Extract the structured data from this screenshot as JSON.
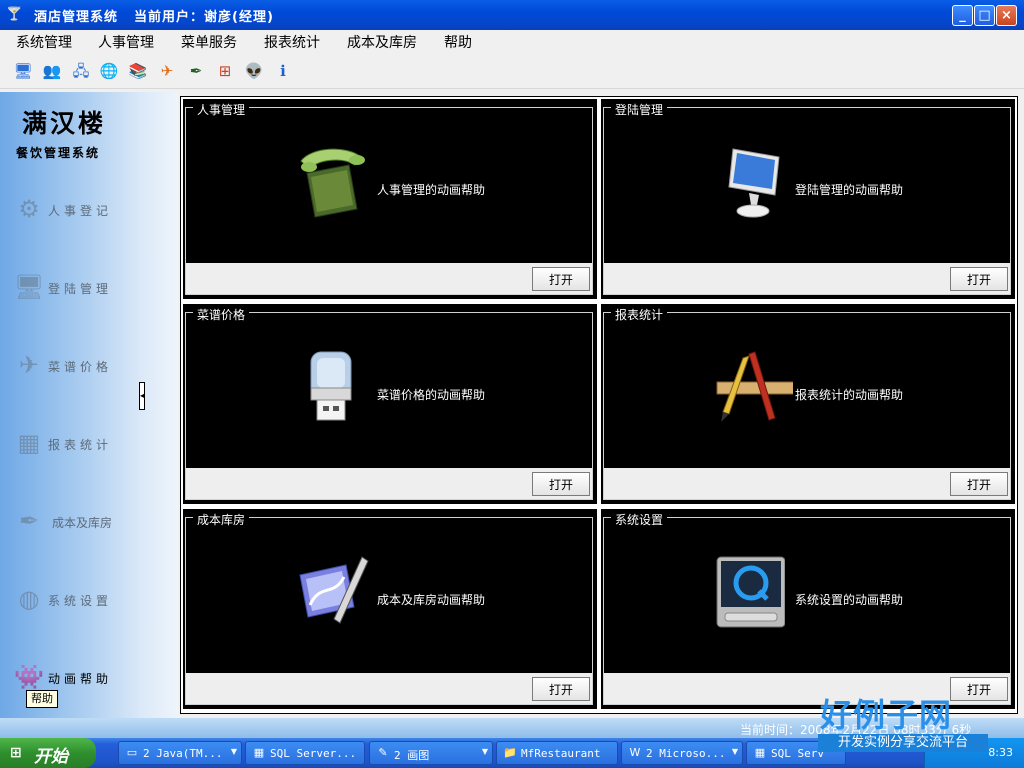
{
  "window": {
    "title": "酒店管理系统",
    "user": "当前用户：谢彦(经理)",
    "controls": {
      "minimize": "_",
      "maximize": "□",
      "close": "×"
    }
  },
  "menus": [
    "系统管理",
    "人事管理",
    "菜单服务",
    "报表统计",
    "成本及库房",
    "帮助"
  ],
  "toolbar": {
    "icons": [
      "monitor-icon",
      "users-icon",
      "network-icon",
      "globe-icon",
      "books-icon",
      "plane-icon",
      "pen-icon",
      "windows-flag-icon",
      "alien-icon",
      "info-icon"
    ],
    "glyphs": [
      "🖥",
      "👥",
      "🖧",
      "🌐",
      "📚",
      "✈",
      "✒",
      "⊞",
      "👽",
      "ℹ"
    ]
  },
  "sidebar": {
    "logo_title": "满汉楼",
    "logo_subtitle": "餐饮管理系统",
    "items": [
      {
        "label": "人事登记",
        "glyph": "⚙"
      },
      {
        "label": "登陆管理",
        "glyph": "🖥"
      },
      {
        "label": "菜谱价格",
        "glyph": "✈"
      },
      {
        "label": "报表统计",
        "glyph": "▦"
      },
      {
        "label": "成本及库房",
        "glyph": "✒"
      },
      {
        "label": "系统设置",
        "glyph": "◍"
      },
      {
        "label": "动画帮助",
        "glyph": "👾"
      }
    ],
    "tooltip": "帮助",
    "splitter_glyph": "◂"
  },
  "panels": [
    {
      "title": "人事管理",
      "desc": "人事管理的动画帮助",
      "button": "打开",
      "icon": "phone-folder-icon"
    },
    {
      "title": "登陆管理",
      "desc": "登陆管理的动画帮助",
      "button": "打开",
      "icon": "imac-icon"
    },
    {
      "title": "菜谱价格",
      "desc": "菜谱价格的动画帮助",
      "button": "打开",
      "icon": "usb-drive-icon"
    },
    {
      "title": "报表统计",
      "desc": "报表统计的动画帮助",
      "button": "打开",
      "icon": "ruler-pencil-icon"
    },
    {
      "title": "成本库房",
      "desc": "成本及库房动画帮助",
      "button": "打开",
      "icon": "vector-pen-icon"
    },
    {
      "title": "系统设置",
      "desc": "系统设置的动画帮助",
      "button": "打开",
      "icon": "quicktime-icon"
    }
  ],
  "status": {
    "time": "当前时间：2008年2月22日 08时33分 6秒"
  },
  "taskbar": {
    "start": "开始",
    "tasks": [
      {
        "label": "2 Java(TM...",
        "icon": "▭",
        "arrow": "▼"
      },
      {
        "label": "SQL Server...",
        "icon": "▦",
        "arrow": ""
      },
      {
        "label": "2 画图",
        "icon": "✎",
        "arrow": "▼"
      },
      {
        "label": "MfRestaurant",
        "icon": "📁",
        "arrow": ""
      },
      {
        "label": "2 Microso...",
        "icon": "W",
        "arrow": "▼"
      },
      {
        "label": "SQL Serv",
        "icon": "▦",
        "arrow": ""
      }
    ],
    "clock": "8:33"
  },
  "watermark": {
    "big": "好例子网",
    "small": "开发实例分享交流平台"
  }
}
